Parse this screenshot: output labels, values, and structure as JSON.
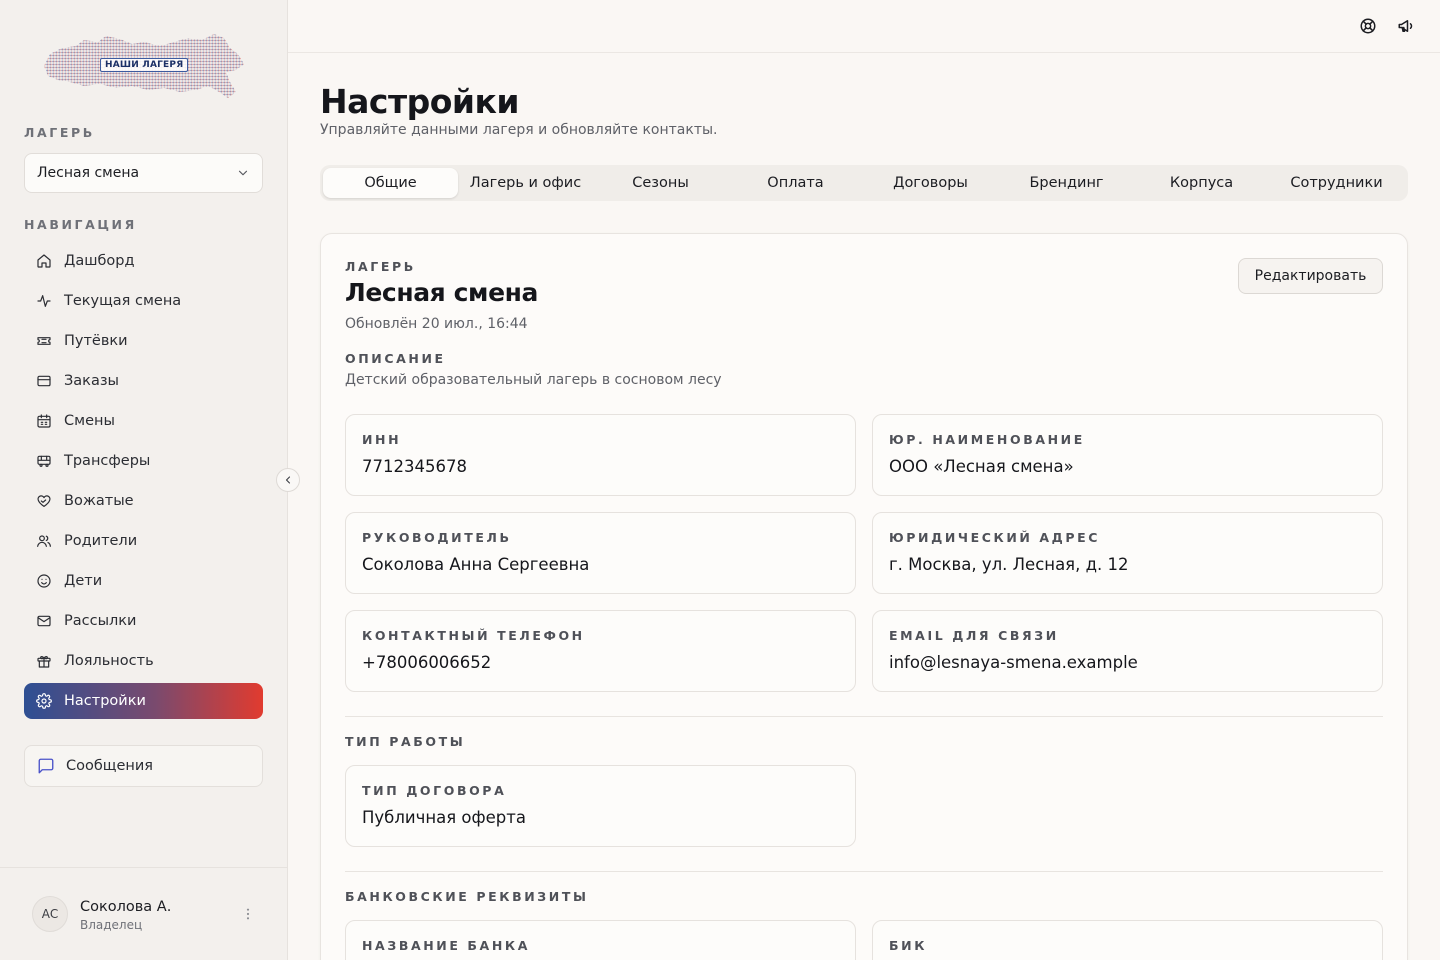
{
  "brand": {
    "logo_text": "НАШИ ЛАГЕРЯ"
  },
  "sidebar": {
    "camp_heading": "ЛАГЕРЬ",
    "camp_select_value": "Лесная смена",
    "nav_heading": "НАВИГАЦИЯ",
    "nav_items": [
      {
        "label": "Дашборд",
        "icon": "home-icon"
      },
      {
        "label": "Текущая смена",
        "icon": "activity-icon"
      },
      {
        "label": "Путёвки",
        "icon": "ticket-icon"
      },
      {
        "label": "Заказы",
        "icon": "credit-card-icon"
      },
      {
        "label": "Смены",
        "icon": "calendar-icon"
      },
      {
        "label": "Трансферы",
        "icon": "bus-icon"
      },
      {
        "label": "Вожатые",
        "icon": "heart-handshake-icon"
      },
      {
        "label": "Родители",
        "icon": "users-icon"
      },
      {
        "label": "Дети",
        "icon": "smile-icon"
      },
      {
        "label": "Рассылки",
        "icon": "mail-icon"
      },
      {
        "label": "Лояльность",
        "icon": "gift-icon"
      },
      {
        "label": "Настройки",
        "icon": "settings-icon",
        "active": true
      }
    ],
    "messages_label": "Сообщения",
    "user": {
      "initials": "АС",
      "name": "Соколова А.",
      "role": "Владелец"
    }
  },
  "topbar": {
    "icons": [
      "help-lifebuoy-icon",
      "megaphone-icon"
    ]
  },
  "page": {
    "title": "Настройки",
    "subtitle": "Управляйте данными лагеря и обновляйте контакты."
  },
  "tabs": [
    {
      "label": "Общие",
      "active": true
    },
    {
      "label": "Лагерь и офис"
    },
    {
      "label": "Сезоны"
    },
    {
      "label": "Оплата"
    },
    {
      "label": "Договоры"
    },
    {
      "label": "Брендинг"
    },
    {
      "label": "Корпуса"
    },
    {
      "label": "Сотрудники"
    }
  ],
  "camp_card": {
    "eyebrow": "ЛАГЕРЬ",
    "title": "Лесная смена",
    "updated": "Обновлён 20 июл., 16:44",
    "edit_label": "Редактировать",
    "description_label": "ОПИСАНИЕ",
    "description": "Детский образовательный лагерь в сосновом лесу",
    "fields": {
      "inn": {
        "label": "ИНН",
        "value": "7712345678"
      },
      "legal_name": {
        "label": "ЮР. НАИМЕНОВАНИЕ",
        "value": "ООО «Лесная смена»"
      },
      "director": {
        "label": "РУКОВОДИТЕЛЬ",
        "value": "Соколова Анна Сергеевна"
      },
      "legal_address": {
        "label": "ЮРИДИЧЕСКИЙ АДРЕС",
        "value": "г. Москва, ул. Лесная, д. 12"
      },
      "phone": {
        "label": "КОНТАКТНЫЙ ТЕЛЕФОН",
        "value": "+78006006652"
      },
      "email": {
        "label": "EMAIL ДЛЯ СВЯЗИ",
        "value": "info@lesnaya-smena.example"
      }
    },
    "work_type_heading": "ТИП РАБОТЫ",
    "contract_type": {
      "label": "ТИП ДОГОВОРА",
      "value": "Публичная оферта"
    },
    "bank_heading": "БАНКОВСКИЕ РЕКВИЗИТЫ",
    "bank_name": {
      "label": "НАЗВАНИЕ БАНКА",
      "value": ""
    },
    "bik": {
      "label": "БИК",
      "value": ""
    }
  },
  "colors": {
    "accent_blue": "#2e4f93",
    "accent_red": "#e13b2f",
    "background": "#faf7f4",
    "sidebar_bg": "#f3f0ed"
  }
}
